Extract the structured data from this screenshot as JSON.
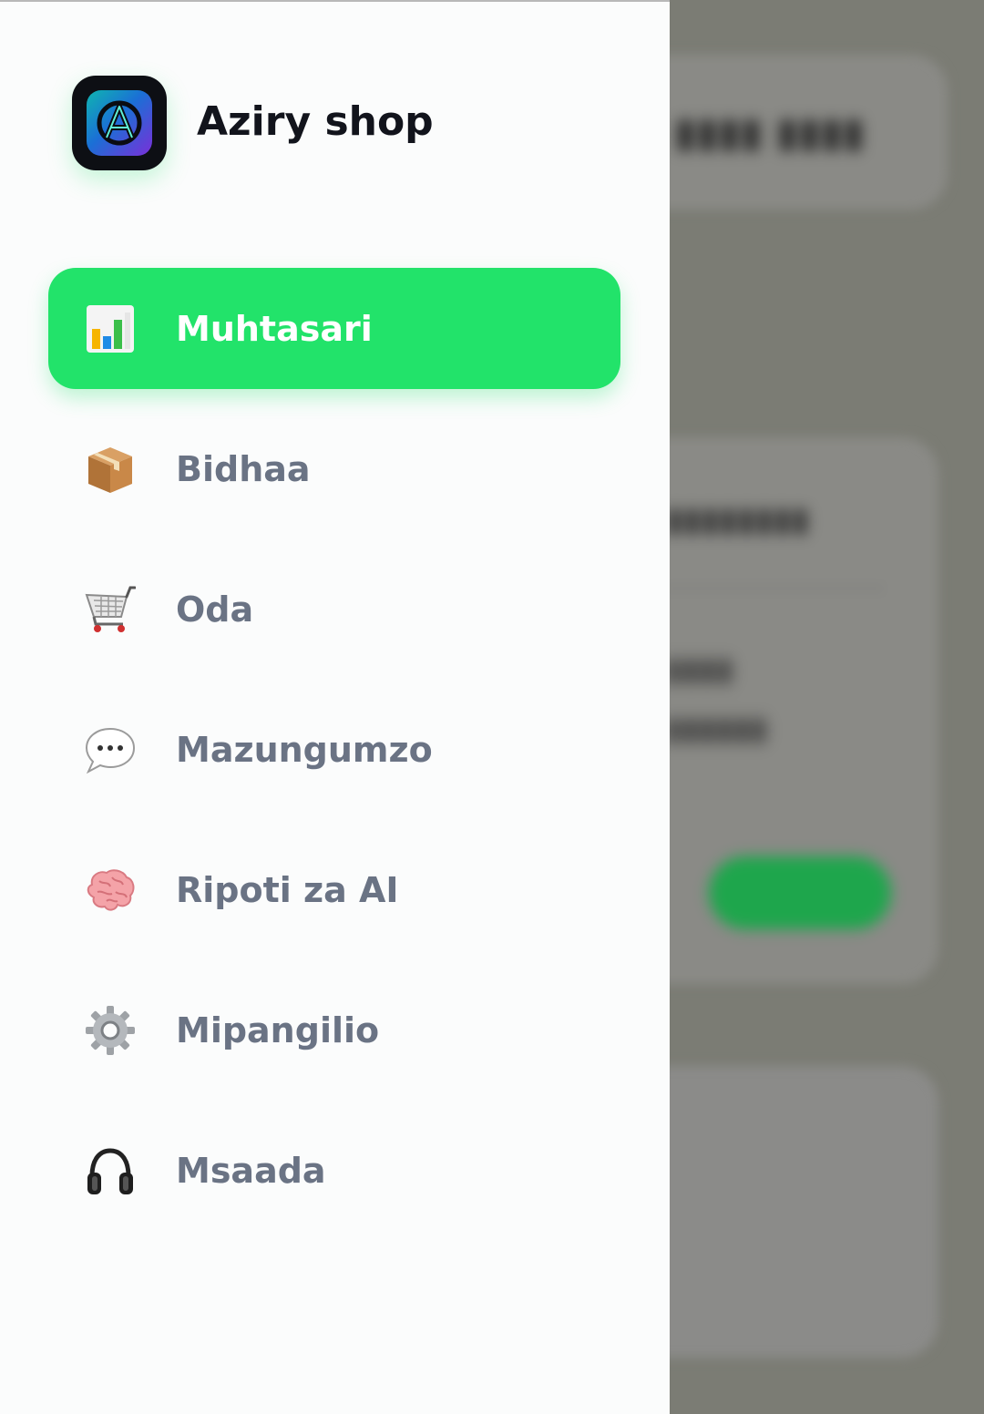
{
  "app": {
    "name": "Aziry shop"
  },
  "nav": {
    "items": [
      {
        "label": "Muhtasari",
        "icon": "bar-chart-icon",
        "active": true
      },
      {
        "label": "Bidhaa",
        "icon": "package-icon",
        "active": false
      },
      {
        "label": "Oda",
        "icon": "shopping-cart-icon",
        "active": false
      },
      {
        "label": "Mazungumzo",
        "icon": "speech-bubble-icon",
        "active": false
      },
      {
        "label": "Ripoti za AI",
        "icon": "brain-icon",
        "active": false
      },
      {
        "label": "Mipangilio",
        "icon": "gear-icon",
        "active": false
      },
      {
        "label": "Msaada",
        "icon": "headphones-icon",
        "active": false
      }
    ]
  },
  "colors": {
    "accent": "#22e36a",
    "drawer_bg": "#fbfcfc",
    "label": "#6a7384",
    "scrim": "#7b7c74"
  }
}
